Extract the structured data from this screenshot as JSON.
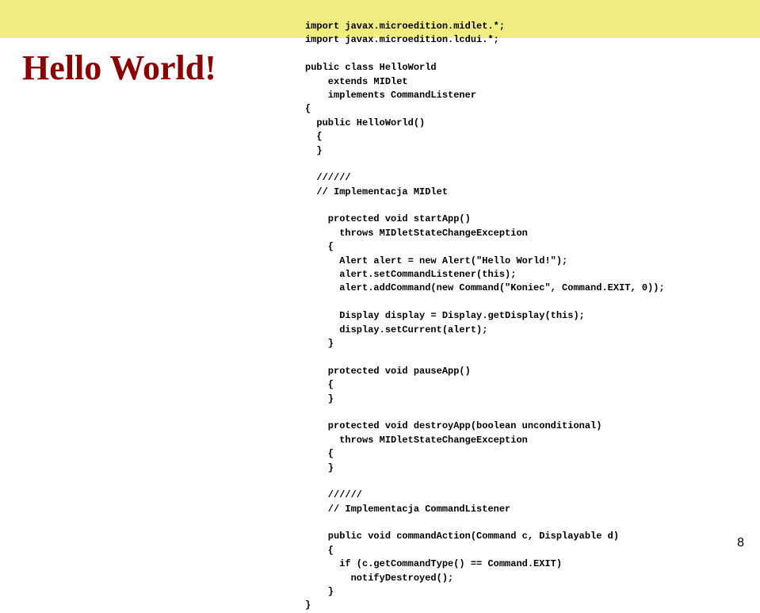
{
  "title": "Hello World!",
  "code": "import javax.microedition.midlet.*;\nimport javax.microedition.lcdui.*;\n\npublic class HelloWorld\n    extends MIDlet\n    implements CommandListener\n{\n  public HelloWorld()\n  {\n  }\n\n  //////\n  // Implementacja MIDlet\n\n    protected void startApp()\n      throws MIDletStateChangeException\n    {\n      Alert alert = new Alert(\"Hello World!\");\n      alert.setCommandListener(this);\n      alert.addCommand(new Command(\"Koniec\", Command.EXIT, 0));\n\n      Display display = Display.getDisplay(this);\n      display.setCurrent(alert);\n    }\n\n    protected void pauseApp()\n    {\n    }\n\n    protected void destroyApp(boolean unconditional)\n      throws MIDletStateChangeException\n    {\n    }\n\n    //////\n    // Implementacja CommandListener\n\n    public void commandAction(Command c, Displayable d)\n    {\n      if (c.getCommandType() == Command.EXIT)\n        notifyDestroyed();\n    }\n}",
  "page_number": "8"
}
